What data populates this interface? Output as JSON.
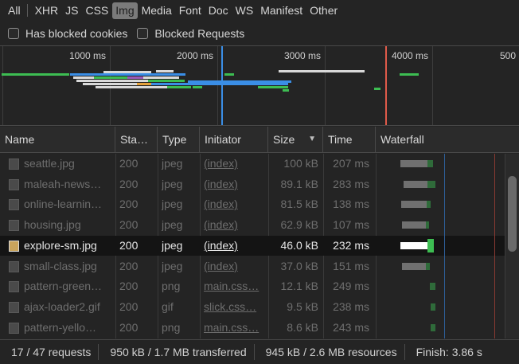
{
  "filters": {
    "types": [
      "All",
      "XHR",
      "JS",
      "CSS",
      "Img",
      "Media",
      "Font",
      "Doc",
      "WS",
      "Manifest",
      "Other"
    ],
    "active": "Img"
  },
  "checkboxes": [
    {
      "label": "Has blocked cookies",
      "checked": false
    },
    {
      "label": "Blocked Requests",
      "checked": false
    }
  ],
  "overview": {
    "ticks": [
      "1000 ms",
      "2000 ms",
      "3000 ms",
      "4000 ms",
      "500"
    ]
  },
  "columns": {
    "name": "Name",
    "status": "Sta…",
    "type": "Type",
    "initiator": "Initiator",
    "size": "Size",
    "time": "Time",
    "waterfall": "Waterfall",
    "sort_indicator": "▼"
  },
  "rows": [
    {
      "name": "seattle.jpg",
      "status": "200",
      "type": "jpeg",
      "initiator": "(index)",
      "size": "100 kB",
      "time": "207 ms",
      "selected": false
    },
    {
      "name": "maleah-news…",
      "status": "200",
      "type": "jpeg",
      "initiator": "(index)",
      "size": "89.1 kB",
      "time": "283 ms",
      "selected": false
    },
    {
      "name": "online-learnin…",
      "status": "200",
      "type": "jpeg",
      "initiator": "(index)",
      "size": "81.5 kB",
      "time": "138 ms",
      "selected": false
    },
    {
      "name": "housing.jpg",
      "status": "200",
      "type": "jpeg",
      "initiator": "(index)",
      "size": "62.9 kB",
      "time": "107 ms",
      "selected": false
    },
    {
      "name": "explore-sm.jpg",
      "status": "200",
      "type": "jpeg",
      "initiator": "(index)",
      "size": "46.0 kB",
      "time": "232 ms",
      "selected": true
    },
    {
      "name": "small-class.jpg",
      "status": "200",
      "type": "jpeg",
      "initiator": "(index)",
      "size": "37.0 kB",
      "time": "151 ms",
      "selected": false
    },
    {
      "name": "pattern-green…",
      "status": "200",
      "type": "png",
      "initiator": "main.css…",
      "size": "12.1 kB",
      "time": "249 ms",
      "selected": false
    },
    {
      "name": "ajax-loader2.gif",
      "status": "200",
      "type": "gif",
      "initiator": "slick.css…",
      "size": "9.5 kB",
      "time": "238 ms",
      "selected": false
    },
    {
      "name": "pattern-yello…",
      "status": "200",
      "type": "png",
      "initiator": "main.css…",
      "size": "8.6 kB",
      "time": "243 ms",
      "selected": false
    }
  ],
  "status_bar": {
    "requests": "17 / 47 requests",
    "transferred": "950 kB / 1.7 MB transferred",
    "resources": "945 kB / 2.6 MB resources",
    "finish": "Finish: 3.86 s"
  },
  "colors": {
    "background": "#242424",
    "header": "#2b2b2b",
    "selected_row": "#141414",
    "waterfall_waiting": "#707070",
    "waterfall_download": "#3dbd52",
    "dom_content_loaded_line": "#3a8ee6",
    "load_line": "#e05a4a"
  }
}
